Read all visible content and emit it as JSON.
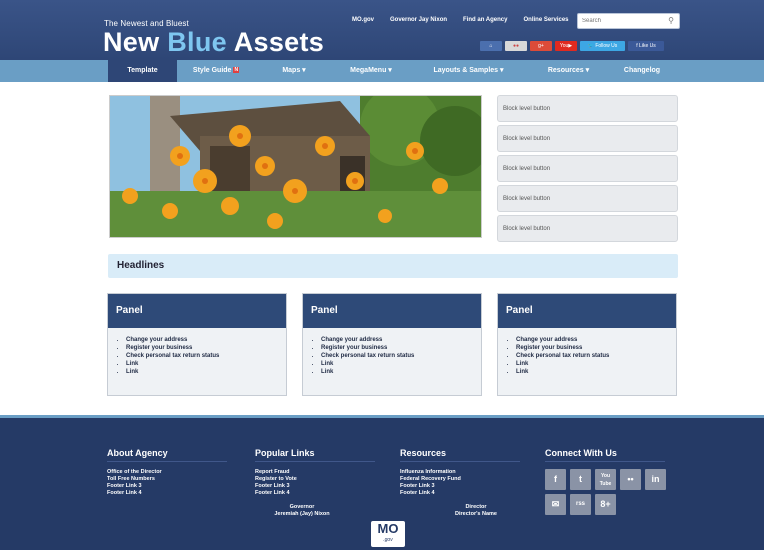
{
  "header": {
    "tagline": "The Newest and Bluest",
    "brand_white": "New ",
    "brand_blue": "Blue",
    "brand_rest": " Assets",
    "links": [
      "MO.gov",
      "Governor Jay Nixon",
      "Find an Agency",
      "Online Services"
    ],
    "search_placeholder": "Search",
    "social": {
      "twitter": "Follow Us",
      "facebook": "Like Us"
    }
  },
  "nav": {
    "items": [
      {
        "label": "Template"
      },
      {
        "label": "Style Guide"
      },
      {
        "label": "Maps ▾"
      },
      {
        "label": "MegaMenu ▾"
      },
      {
        "label": "Layouts & Samples ▾"
      },
      {
        "label": "Resources ▾"
      },
      {
        "label": "Changelog"
      }
    ]
  },
  "blocks": [
    "Block level button",
    "Block level button",
    "Block level button",
    "Block level button",
    "Block level button"
  ],
  "headlines": "Headlines",
  "panels": [
    {
      "title": "Panel",
      "items": [
        "Change your address",
        "Register your business",
        "Check personal tax return status",
        "Link",
        "Link"
      ]
    },
    {
      "title": "Panel",
      "items": [
        "Change your address",
        "Register your business",
        "Check personal tax return status",
        "Link",
        "Link"
      ]
    },
    {
      "title": "Panel",
      "items": [
        "Change your address",
        "Register your business",
        "Check personal tax return status",
        "Link",
        "Link"
      ]
    }
  ],
  "footer": {
    "about": {
      "title": "About Agency",
      "links": [
        "Office of the Director",
        "Toll Free Numbers",
        "Footer Link 3",
        "Footer Link 4"
      ]
    },
    "popular": {
      "title": "Popular Links",
      "links": [
        "Report Fraud",
        "Register to Vote",
        "Footer Link 3",
        "Footer Link 4"
      ]
    },
    "resources": {
      "title": "Resources",
      "links": [
        "Influenza Information",
        "Federal Recovery Fund",
        "Footer Link 3",
        "Footer Link 4"
      ]
    },
    "connect": {
      "title": "Connect With Us",
      "icons": [
        "f",
        "t",
        "You Tube",
        "••",
        "in",
        "✉",
        "rss",
        "8+"
      ]
    },
    "governor_title": "Governor",
    "governor_name": "Jeremiah (Jay) Nixon",
    "director_title": "Director",
    "director_name": "Director's Name",
    "logo_main": "MO",
    "logo_sub": ".gov"
  },
  "colors": {
    "header": "#2e4676",
    "nav": "#6a9ec5",
    "brand_accent": "#7ec6f0",
    "panel_head": "#2e4a78",
    "footer": "#253a66"
  }
}
